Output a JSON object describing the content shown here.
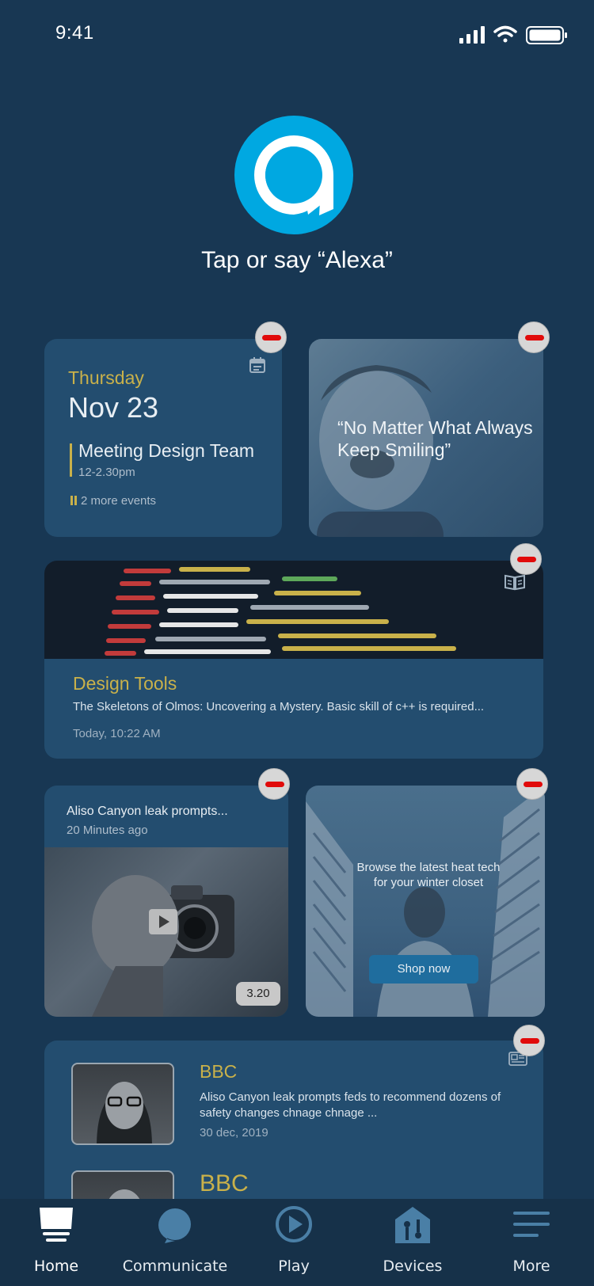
{
  "status_bar": {
    "time": "9:41"
  },
  "alexa": {
    "prompt": "Tap or say “Alexa”"
  },
  "calendar_card": {
    "day": "Thursday",
    "date": "Nov 23",
    "event_title": "Meeting Design Team",
    "event_time": "12-2.30pm",
    "more_events": "2 more events"
  },
  "quote_card": {
    "quote": "“No Matter What Always Keep Smiling”"
  },
  "article_card": {
    "title": "Design Tools",
    "description": "The Skeletons of Olmos: Uncovering a Mystery. Basic skill of c++ is required...",
    "timestamp": "Today, 10:22 AM"
  },
  "video_card": {
    "title": "Aliso Canyon leak prompts...",
    "time_ago": "20 Minutes ago",
    "duration": "3.20"
  },
  "shop_card": {
    "text": "Browse the latest heat tech for your winter closet",
    "button_label": "Shop now"
  },
  "news_card": {
    "items": [
      {
        "source": "BBC",
        "description": "Aliso Canyon leak prompts feds to recommend dozens of safety changes chnage chnage ...",
        "date": "30 dec, 2019"
      },
      {
        "source": "BBC"
      }
    ]
  },
  "bottom_nav": {
    "items": [
      {
        "label": "Home",
        "icon": "home-icon",
        "active": true
      },
      {
        "label": "Communicate",
        "icon": "chat-bubble-icon",
        "active": false
      },
      {
        "label": "Play",
        "icon": "play-icon",
        "active": false
      },
      {
        "label": "Devices",
        "icon": "devices-icon",
        "active": false
      },
      {
        "label": "More",
        "icon": "menu-icon",
        "active": false
      }
    ]
  },
  "colors": {
    "background": "#183753",
    "card": "#234d6f",
    "accent_gold": "#c9b14a",
    "alexa_blue": "#00a8e1",
    "remove_red": "#e10b0b"
  }
}
